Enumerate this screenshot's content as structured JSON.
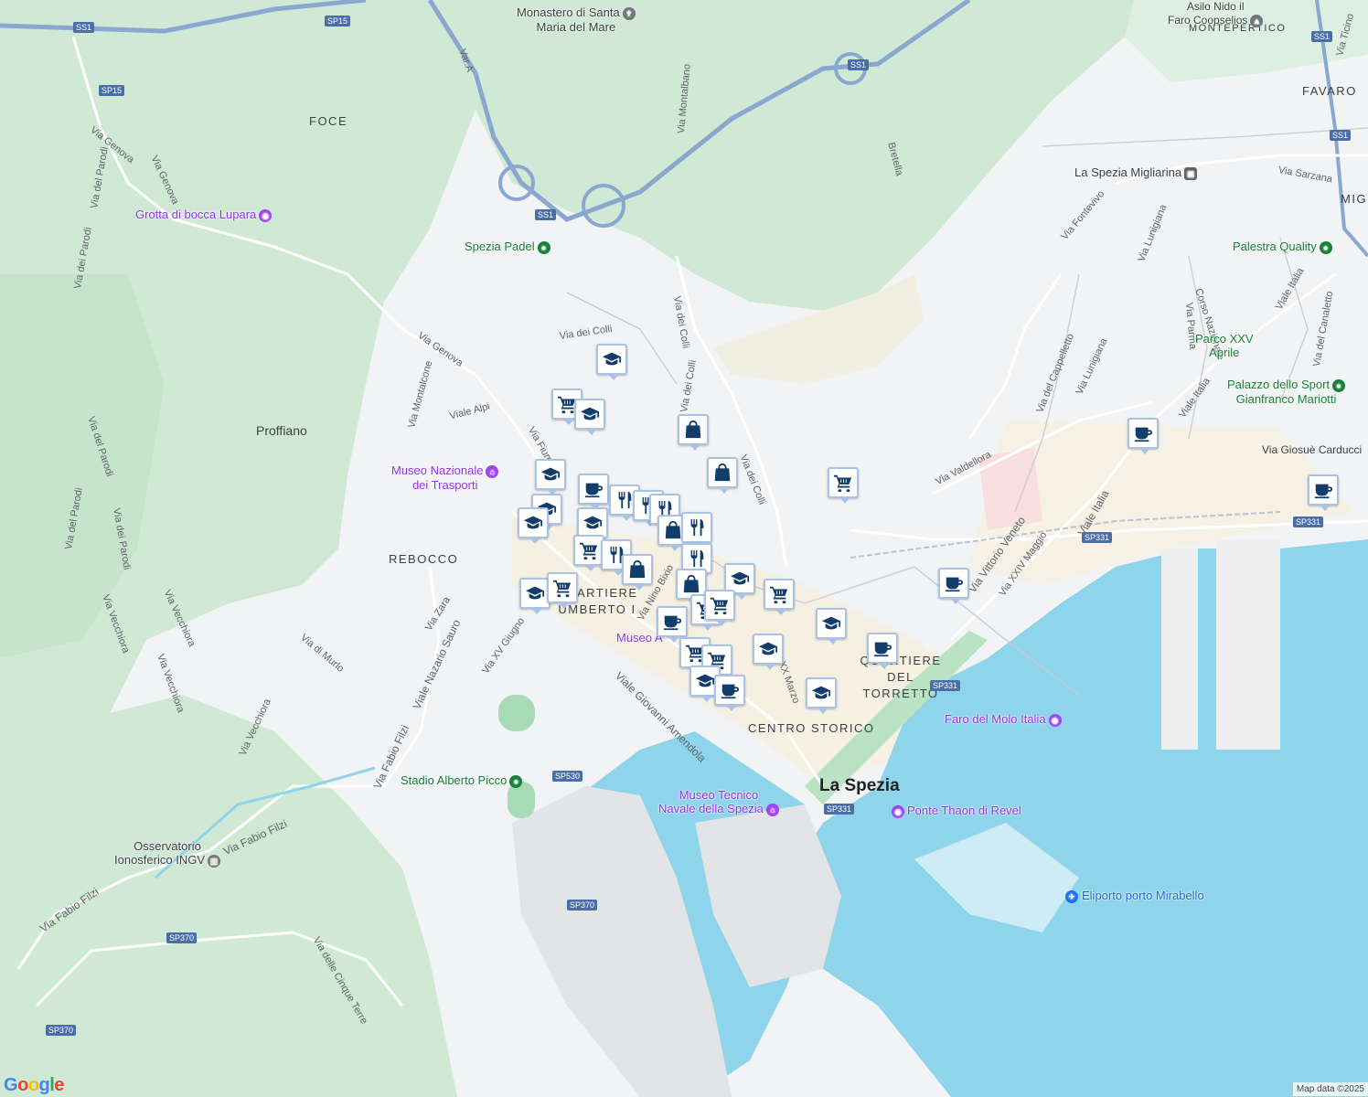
{
  "map": {
    "attribution": "Map data ©2025",
    "logo": "Google"
  },
  "areas": [
    {
      "id": "foce",
      "text": "FOCE"
    },
    {
      "id": "rebocco",
      "text": "REBOCCO"
    },
    {
      "id": "favaro",
      "text": "FAVARO"
    },
    {
      "id": "montepertico",
      "text": "MONTEPERTICO"
    },
    {
      "id": "mig",
      "text": "MIG"
    },
    {
      "id": "quartiere-umberto",
      "text": "QUARTIERE UMBERTO I"
    },
    {
      "id": "quartiere-torretto",
      "text": "QUARTIERE DEL TORRETTO"
    },
    {
      "id": "centro-storico",
      "text": "CENTRO STORICO"
    }
  ],
  "towns": [
    {
      "id": "proffiano",
      "text": "Proffiano"
    },
    {
      "id": "la-spezia",
      "text": "La Spezia"
    }
  ],
  "streets": [
    "Via Genova",
    "Via Genova",
    "Via del Parodi",
    "Via dei Parodi",
    "Via del Parodi",
    "Via dei Parodi",
    "Via del Parodi",
    "Via Montalcone",
    "Via Genova",
    "Viale Alpi",
    "Via Fiume",
    "Via dei Colli",
    "Via dei Colli",
    "Via dei Colli",
    "Via dei Colli",
    "Via Montalbano",
    "Bretella",
    "Via Fontevivo",
    "Via Lunigiana",
    "Via Lunigiana",
    "Via del Cappelletto",
    "Via Valdellora",
    "Via Sarzana",
    "Via Parma",
    "Corso Nazionale",
    "Viale Italia",
    "Viale Italia",
    "Via del Canaletto",
    "Via Giosuè Carducci",
    "Via Vittorio Veneto",
    "Via XXIV Maggio",
    "Viale Italia",
    "Via Zara",
    "Viale Nazario Sauro",
    "Via XV Giugno",
    "Via di Murlo",
    "Via Vecchiora",
    "Via Vecchiora",
    "Via Vecchiora",
    "Via Vecchiora",
    "Via Fabio Filzi",
    "Via Fabio Filzi",
    "Via Fabio Filzi",
    "Viale Giovanni Amendola",
    "Via delle Cinque Terre",
    "Via Nino Bixio",
    "Via Ticino",
    "Var.A",
    "Via XX Marzo",
    "Via dei Colli",
    "Via Colli"
  ],
  "shields": [
    "SS1",
    "SP15",
    "SP15",
    "SS1",
    "SS1",
    "SS1",
    "SS1",
    "SP331",
    "SP331",
    "SP331",
    "SP331",
    "SP530",
    "SP370",
    "SP370",
    "SP370"
  ],
  "pois": [
    {
      "id": "monastero",
      "text": "Monastero di Santa Maria del Mare",
      "line1": "Monastero di Santa",
      "line2": "Maria del Mare",
      "color": "dark"
    },
    {
      "id": "asilo",
      "text": "Asilo Nido il Faro Coopselios",
      "line1": "Asilo Nido il",
      "line2": "Faro Coopselios",
      "color": "dark"
    },
    {
      "id": "grotta",
      "text": "Grotta di bocca Lupara",
      "color": "purple"
    },
    {
      "id": "padel",
      "text": "Spezia Padel",
      "color": "green"
    },
    {
      "id": "migliarina",
      "text": "La Spezia Migliarina",
      "color": "dark"
    },
    {
      "id": "palestra",
      "text": "Palestra Quality",
      "color": "green"
    },
    {
      "id": "parco",
      "text": "Parco XXV Aprile",
      "line1": "Parco XXV",
      "line2": "Aprile",
      "color": "green"
    },
    {
      "id": "palazzo",
      "text": "Palazzo dello Sport Gianfranco Mariotti",
      "line1": "Palazzo dello Sport",
      "line2": "Gianfranco Mariotti",
      "color": "green"
    },
    {
      "id": "museo-trasporti",
      "text": "Museo Nazionale dei Trasporti",
      "line1": "Museo Nazionale",
      "line2": "dei Trasporti",
      "color": "purple"
    },
    {
      "id": "museo-a",
      "text": "Museo A",
      "color": "purple"
    },
    {
      "id": "faro",
      "text": "Faro del Molo Italia",
      "color": "purple"
    },
    {
      "id": "stadio",
      "text": "Stadio Alberto Picco",
      "color": "green"
    },
    {
      "id": "museo-navale",
      "text": "Museo Tecnico Navale della Spezia",
      "line1": "Museo Tecnico",
      "line2": "Navale della Spezia",
      "color": "purple"
    },
    {
      "id": "ponte",
      "text": "Ponte Thaon di Revel",
      "color": "purple"
    },
    {
      "id": "osservatorio",
      "text": "Osservatorio Ionosferico INGV",
      "line1": "Osservatorio",
      "line2": "Ionosferico INGV",
      "color": "dark"
    },
    {
      "id": "eliporto",
      "text": "Eliporto porto Mirabello",
      "color": "blue"
    }
  ],
  "markers": [
    {
      "type": "school-icon"
    },
    {
      "type": "cart-icon"
    },
    {
      "type": "school-icon"
    },
    {
      "type": "bag-icon"
    },
    {
      "type": "bag-icon"
    },
    {
      "type": "cart-icon"
    },
    {
      "type": "school-icon"
    },
    {
      "type": "cup-icon"
    },
    {
      "type": "fork-icon"
    },
    {
      "type": "school-icon"
    },
    {
      "type": "fork-icon"
    },
    {
      "type": "fork-icon"
    },
    {
      "type": "school-icon"
    },
    {
      "type": "school-icon"
    },
    {
      "type": "bag-icon"
    },
    {
      "type": "fork-icon"
    },
    {
      "type": "cart-icon"
    },
    {
      "type": "fork-icon"
    },
    {
      "type": "bag-icon"
    },
    {
      "type": "fork-icon"
    },
    {
      "type": "school-icon"
    },
    {
      "type": "bag-icon"
    },
    {
      "type": "cart-icon"
    },
    {
      "type": "school-icon"
    },
    {
      "type": "cart-icon"
    },
    {
      "type": "cart-icon"
    },
    {
      "type": "cup-icon"
    },
    {
      "type": "cart-icon"
    },
    {
      "type": "school-icon"
    },
    {
      "type": "cup-icon"
    },
    {
      "type": "school-icon"
    },
    {
      "type": "cart-icon"
    },
    {
      "type": "school-icon"
    },
    {
      "type": "cup-icon"
    },
    {
      "type": "school-icon"
    },
    {
      "type": "cup-icon"
    },
    {
      "type": "cup-icon"
    },
    {
      "type": "cup-icon"
    },
    {
      "type": "cart-icon"
    }
  ]
}
